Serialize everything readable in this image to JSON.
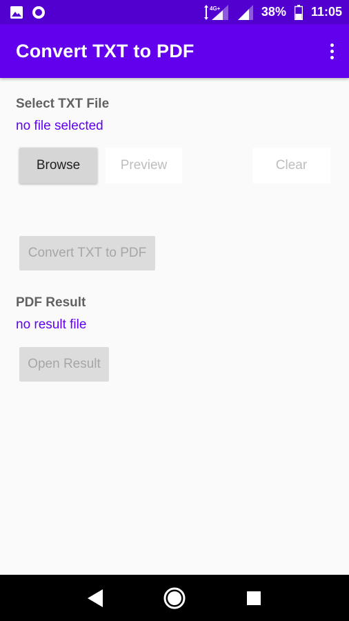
{
  "status_bar": {
    "network_badge": "4G+",
    "battery": "38%",
    "time": "11:05"
  },
  "app_bar": {
    "title": "Convert TXT to PDF",
    "overflow_icon": "more-vert-icon"
  },
  "input_section": {
    "label": "Select TXT File",
    "value": "no file selected",
    "buttons": {
      "browse": "Browse",
      "preview": "Preview",
      "clear": "Clear"
    }
  },
  "convert_button": "Convert TXT to PDF",
  "result_section": {
    "label": "PDF Result",
    "value": "no result file",
    "open_button": "Open Result"
  },
  "colors": {
    "primary": "#6200ee",
    "status_bar": "#5200d0",
    "accent_text": "#6200ee"
  }
}
